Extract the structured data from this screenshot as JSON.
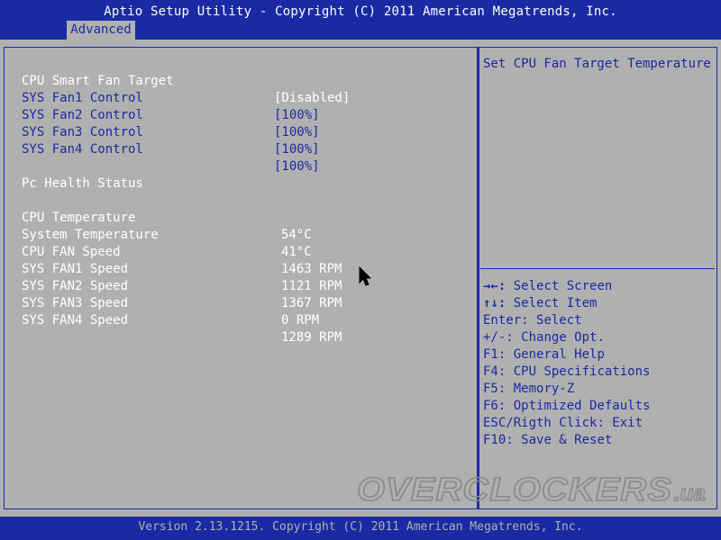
{
  "header": {
    "title": "Aptio Setup Utility - Copyright (C) 2011 American Megatrends, Inc.",
    "active_tab": "Advanced"
  },
  "settings": [
    {
      "label": "CPU Smart Fan Target",
      "value": "[Disabled]"
    },
    {
      "label": "SYS Fan1 Control",
      "value": "[100%]"
    },
    {
      "label": "SYS Fan2 Control",
      "value": "[100%]"
    },
    {
      "label": "SYS Fan3 Control",
      "value": "[100%]"
    },
    {
      "label": "SYS Fan4 Control",
      "value": "[100%]"
    }
  ],
  "health": {
    "section_title": "Pc Health Status",
    "items": [
      {
        "label": "CPU Temperature",
        "value": "54°C"
      },
      {
        "label": "System Temperature",
        "value": "41°C"
      },
      {
        "label": "CPU FAN Speed",
        "value": "1463 RPM"
      },
      {
        "label": "SYS FAN1 Speed",
        "value": "1121 RPM"
      },
      {
        "label": "SYS FAN2 Speed",
        "value": "1367 RPM"
      },
      {
        "label": "SYS FAN3 Speed",
        "value": "0 RPM"
      },
      {
        "label": "SYS FAN4 Speed",
        "value": "1289 RPM"
      }
    ]
  },
  "help": {
    "description": "Set CPU Fan Target Temperature",
    "keys": [
      {
        "key": "→←:",
        "action": "Select Screen"
      },
      {
        "key": "↑↓:",
        "action": "Select Item"
      },
      {
        "key": "Enter:",
        "action": "Select"
      },
      {
        "key": "+/-:",
        "action": "Change Opt."
      },
      {
        "key": "F1:",
        "action": "General Help"
      },
      {
        "key": "F4:",
        "action": "CPU Specifications"
      },
      {
        "key": "F5:",
        "action": "Memory-Z"
      },
      {
        "key": "F6:",
        "action": "Optimized Defaults"
      },
      {
        "key": "ESC/Rigth Click:",
        "action": "Exit"
      },
      {
        "key": "F10:",
        "action": "Save & Reset"
      }
    ]
  },
  "footer": {
    "version": "Version 2.13.1215. Copyright (C) 2011 American Megatrends, Inc."
  },
  "watermark": {
    "brand": "OVERCLOCKERS",
    "suffix": ".ua"
  },
  "colors": {
    "bar_blue": "#1a2aa4",
    "background_gray": "#b0b0b0",
    "text_white": "#ffffff"
  }
}
